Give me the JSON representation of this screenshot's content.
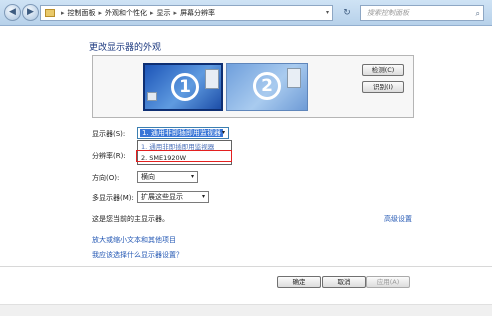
{
  "nav": {
    "back": "◀",
    "forward": "▶",
    "dropdown": "▾",
    "refresh": "↻"
  },
  "breadcrumb": {
    "sep": "▸",
    "items": [
      "控制面板",
      "外观和个性化",
      "显示",
      "屏幕分辨率"
    ]
  },
  "search": {
    "placeholder": "搜索控制面板",
    "icon": "⌕"
  },
  "page": {
    "title": "更改显示器的外观"
  },
  "monitors": [
    {
      "number": "1",
      "selected": true
    },
    {
      "number": "2",
      "selected": false
    }
  ],
  "buttons": {
    "detect": "检测(C)",
    "identify": "识别(I)",
    "ok": "确定",
    "cancel": "取消",
    "apply": "应用(A)"
  },
  "form": {
    "display_label": "显示器(S):",
    "display_value": "1. 通用非即插即用监视器",
    "resolution_label": "分辨率(R):",
    "orientation_label": "方向(O):",
    "orientation_value": "横向",
    "multi_label": "多显示器(M):",
    "multi_value": "扩展这些显示"
  },
  "dropdown": {
    "options": [
      "1. 通用非即插即用监视器",
      "2. SME1920W"
    ]
  },
  "hint": "这是您当前的主显示器。",
  "advanced": "高级设置",
  "links": [
    "放大或缩小文本和其他项目",
    "我应该选择什么显示器设置？"
  ],
  "colors": {
    "title": "#1d3a80",
    "link": "#2458b4",
    "selection": "#3875d7",
    "highlight_box": "#e32020"
  }
}
